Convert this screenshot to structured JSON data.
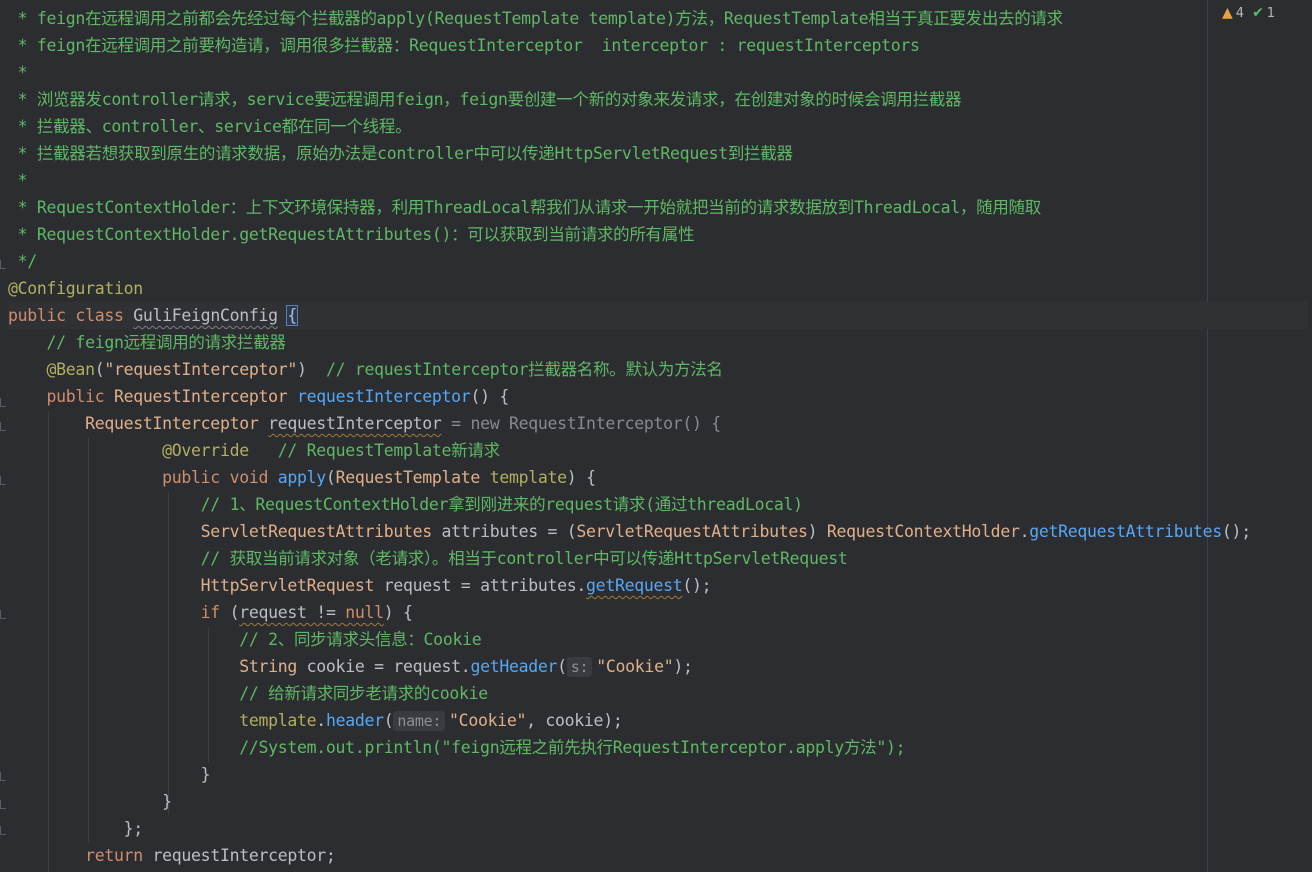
{
  "inspection": {
    "warnings": "4",
    "weak_warnings": "1",
    "warning_icon": "warning-triangle-icon",
    "weak_icon": "double-check-icon"
  },
  "colors": {
    "background": "#2b2d30",
    "comment": "#5fb865",
    "keyword": "#cf8e6d",
    "annotation": "#b3ae60",
    "method": "#56a8f5",
    "string": "#e0b08a"
  },
  "lines": [
    [
      {
        "t": " * feign在远程调用之前都会先经过每个拦截器的apply(RequestTemplate template)方法，RequestTemplate相当于真正要发出去的请求",
        "c": "cmt"
      }
    ],
    [
      {
        "t": " * feign在远程调用之前要构造请，调用很多拦截器：RequestInterceptor  interceptor : requestInterceptors",
        "c": "cmt"
      }
    ],
    [
      {
        "t": " *",
        "c": "cmt"
      }
    ],
    [
      {
        "t": " * 浏览器发controller请求，service要远程调用feign，feign要创建一个新的对象来发请求，在创建对象的时候会调用拦截器",
        "c": "cmt"
      }
    ],
    [
      {
        "t": " * 拦截器、controller、service都在同一个线程。",
        "c": "cmt"
      }
    ],
    [
      {
        "t": " * 拦截器若想获取到原生的请求数据，原始办法是controller中可以传递HttpServletRequest到拦截器",
        "c": "cmt"
      }
    ],
    [
      {
        "t": " *",
        "c": "cmt"
      }
    ],
    [
      {
        "t": " * RequestContextHolder：上下文环境保持器，利用ThreadLocal帮我们从请求一开始就把当前的请求数据放到ThreadLocal，随用随取",
        "c": "cmt"
      }
    ],
    [
      {
        "t": " * RequestContextHolder.getRequestAttributes()：可以获取到当前请求的所有属性",
        "c": "cmt"
      }
    ],
    [
      {
        "t": " */",
        "c": "cmt"
      }
    ],
    [
      {
        "t": "@Configuration",
        "c": "ann"
      }
    ],
    [
      {
        "t": "public class ",
        "c": "kw"
      },
      {
        "t": "GuliFeignConfig",
        "c": "txt uline2"
      },
      {
        "t": " ",
        "c": "txt"
      },
      {
        "t": "{",
        "c": "txt caret-brace"
      }
    ],
    [
      {
        "t": "    // feign远程调用的请求拦截器",
        "c": "cmt"
      }
    ],
    [
      {
        "t": "    @Bean",
        "c": "ann"
      },
      {
        "t": "(",
        "c": "txt"
      },
      {
        "t": "\"requestInterceptor\"",
        "c": "str"
      },
      {
        "t": ")  ",
        "c": "txt"
      },
      {
        "t": "// requestInterceptor拦截器名称。默认为方法名",
        "c": "cmt"
      }
    ],
    [
      {
        "t": "    public ",
        "c": "kw"
      },
      {
        "t": "RequestInterceptor ",
        "c": "str"
      },
      {
        "t": "requestInterceptor",
        "c": "fn"
      },
      {
        "t": "() {",
        "c": "txt"
      }
    ],
    [
      {
        "t": "        RequestInterceptor ",
        "c": "str"
      },
      {
        "t": "requestInterceptor",
        "c": "txt uline"
      },
      {
        "t": " = ",
        "c": "muted"
      },
      {
        "t": "new RequestInterceptor() {",
        "c": "muted"
      }
    ],
    [
      {
        "t": "                @Override",
        "c": "ann"
      },
      {
        "t": "   ",
        "c": "txt"
      },
      {
        "t": "// RequestTemplate新请求",
        "c": "cmt"
      }
    ],
    [
      {
        "t": "                public void ",
        "c": "kw"
      },
      {
        "t": "apply",
        "c": "fn"
      },
      {
        "t": "(",
        "c": "txt"
      },
      {
        "t": "RequestTemplate ",
        "c": "str"
      },
      {
        "t": "template",
        "c": "ann"
      },
      {
        "t": ") {",
        "c": "txt"
      }
    ],
    [
      {
        "t": "                    // 1、RequestContextHolder拿到刚进来的request请求(通过threadLocal)",
        "c": "cmt"
      }
    ],
    [
      {
        "t": "                    ServletRequestAttributes ",
        "c": "str"
      },
      {
        "t": "attributes = (",
        "c": "txt"
      },
      {
        "t": "ServletRequestAttributes",
        "c": "str"
      },
      {
        "t": ") ",
        "c": "txt"
      },
      {
        "t": "RequestContextHolder",
        "c": "str"
      },
      {
        "t": ".",
        "c": "txt"
      },
      {
        "t": "getRequestAttributes",
        "c": "fn"
      },
      {
        "t": "();",
        "c": "txt"
      }
    ],
    [
      {
        "t": "                    // 获取当前请求对象（老请求）。相当于controller中可以传递HttpServletRequest",
        "c": "cmt"
      }
    ],
    [
      {
        "t": "                    HttpServletRequest ",
        "c": "str"
      },
      {
        "t": "request = attributes.",
        "c": "txt"
      },
      {
        "t": "getRequest",
        "c": "fn uline"
      },
      {
        "t": "();",
        "c": "txt"
      }
    ],
    [
      {
        "t": "                    if ",
        "c": "kw"
      },
      {
        "t": "(",
        "c": "txt"
      },
      {
        "t": "request != ",
        "c": "txt uline"
      },
      {
        "t": "null",
        "c": "kw uline"
      },
      {
        "t": ") {",
        "c": "txt"
      }
    ],
    [
      {
        "t": "                        // 2、同步请求头信息：Cookie",
        "c": "cmt"
      }
    ],
    [
      {
        "t": "                        String ",
        "c": "str"
      },
      {
        "t": "cookie = request.",
        "c": "txt"
      },
      {
        "t": "getHeader",
        "c": "fn"
      },
      {
        "t": "(",
        "c": "txt"
      },
      {
        "h": "s:"
      },
      {
        "t": "\"Cookie\"",
        "c": "str"
      },
      {
        "t": ");",
        "c": "txt"
      }
    ],
    [
      {
        "t": "                        // 给新请求同步老请求的cookie",
        "c": "cmt"
      }
    ],
    [
      {
        "t": "                        template",
        "c": "ann"
      },
      {
        "t": ".",
        "c": "txt"
      },
      {
        "t": "header",
        "c": "fn"
      },
      {
        "t": "(",
        "c": "txt"
      },
      {
        "h": "name:"
      },
      {
        "t": "\"Cookie\"",
        "c": "str"
      },
      {
        "t": ", cookie);",
        "c": "txt"
      }
    ],
    [
      {
        "t": "                        //System.out.println(\"feign远程之前先执行RequestInterceptor.apply方法\");",
        "c": "cmt"
      }
    ],
    [
      {
        "t": "                    }",
        "c": "txt"
      }
    ],
    [
      {
        "t": "                }",
        "c": "txt"
      }
    ],
    [
      {
        "t": "            };",
        "c": "txt"
      }
    ],
    [
      {
        "t": "        return ",
        "c": "kw"
      },
      {
        "t": "requestInterceptor;",
        "c": "txt"
      }
    ]
  ]
}
